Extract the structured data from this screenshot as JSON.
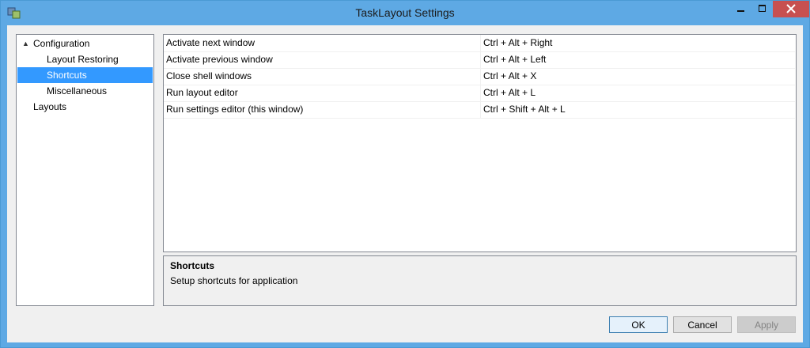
{
  "window": {
    "title": "TaskLayout Settings"
  },
  "tree": {
    "items": [
      {
        "label": "Configuration",
        "expander": "▲"
      },
      {
        "label": "Layout Restoring"
      },
      {
        "label": "Shortcuts"
      },
      {
        "label": "Miscellaneous"
      },
      {
        "label": "Layouts"
      }
    ]
  },
  "shortcuts": {
    "rows": [
      {
        "action": "Activate next window",
        "keys": "Ctrl + Alt + Right"
      },
      {
        "action": "Activate previous window",
        "keys": "Ctrl + Alt + Left"
      },
      {
        "action": "Close shell windows",
        "keys": "Ctrl + Alt + X"
      },
      {
        "action": "Run layout editor",
        "keys": "Ctrl + Alt + L"
      },
      {
        "action": "Run settings editor (this window)",
        "keys": "Ctrl + Shift + Alt + L"
      }
    ]
  },
  "description": {
    "title": "Shortcuts",
    "text": "Setup shortcuts for application"
  },
  "buttons": {
    "ok": "OK",
    "cancel": "Cancel",
    "apply": "Apply"
  },
  "colors": {
    "selection": "#3399ff",
    "titlebar": "#5ea9e4",
    "close": "#c75050"
  },
  "icons": {
    "app": "app-icon",
    "minimize": "minimize-icon",
    "maximize": "maximize-icon",
    "close": "close-icon"
  }
}
